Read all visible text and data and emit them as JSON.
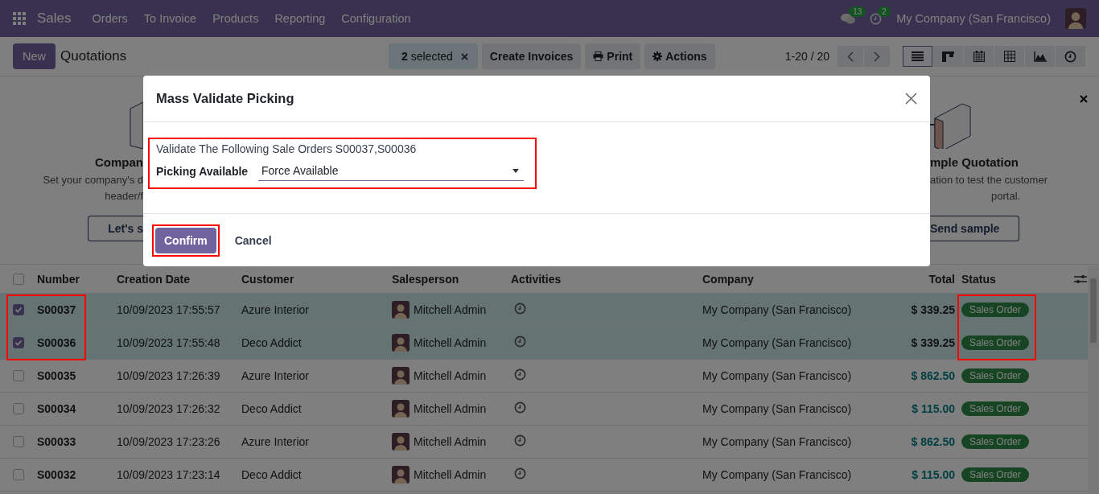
{
  "navbar": {
    "app": "Sales",
    "menu": [
      "Orders",
      "To Invoice",
      "Products",
      "Reporting",
      "Configuration"
    ],
    "messages_badge": "13",
    "activities_badge": "2",
    "company": "My Company (San Francisco)"
  },
  "control_panel": {
    "new_button": "New",
    "title": "Quotations",
    "selection": {
      "count": "2",
      "label": "selected"
    },
    "actions": [
      {
        "label": "Create Invoices",
        "kind": "plain"
      },
      {
        "label": "Print",
        "kind": "printer"
      },
      {
        "label": "Actions",
        "kind": "gear"
      }
    ],
    "pager": "1-20 / 20",
    "views": [
      {
        "kind": "list",
        "selected": true
      },
      {
        "kind": "kanban",
        "selected": false
      },
      {
        "kind": "calendar",
        "selected": false
      },
      {
        "kind": "pivot",
        "selected": false
      },
      {
        "kind": "graph",
        "selected": false
      },
      {
        "kind": "activity",
        "selected": false
      }
    ]
  },
  "helper": {
    "left": {
      "title": "Compan",
      "lines": [
        "Set your company's d",
        "header/f"
      ],
      "button": "Let's s"
    },
    "right": {
      "title": "mple Quotation",
      "lines": [
        "ation to test the customer",
        "portal."
      ],
      "button": "Send sample"
    }
  },
  "table": {
    "header_checked": false,
    "columns": [
      "Number",
      "Creation Date",
      "Customer",
      "Salesperson",
      "Activities",
      "Company",
      "Total",
      "Status"
    ],
    "rows": [
      {
        "number": "S00037",
        "created": "10/09/2023 17:55:57",
        "customer": "Azure Interior",
        "salesperson": "Mitchell Admin",
        "company": "My Company (San Francisco)",
        "total": "$ 339.25",
        "status": "Sales Order",
        "selected": true
      },
      {
        "number": "S00036",
        "created": "10/09/2023 17:55:48",
        "customer": "Deco Addict",
        "salesperson": "Mitchell Admin",
        "company": "My Company (San Francisco)",
        "total": "$ 339.25",
        "status": "Sales Order",
        "selected": true
      },
      {
        "number": "S00035",
        "created": "10/09/2023 17:26:39",
        "customer": "Azure Interior",
        "salesperson": "Mitchell Admin",
        "company": "My Company (San Francisco)",
        "total": "$ 862.50",
        "status": "Sales Order",
        "selected": false
      },
      {
        "number": "S00034",
        "created": "10/09/2023 17:26:32",
        "customer": "Deco Addict",
        "salesperson": "Mitchell Admin",
        "company": "My Company (San Francisco)",
        "total": "$ 115.00",
        "status": "Sales Order",
        "selected": false
      },
      {
        "number": "S00033",
        "created": "10/09/2023 17:23:26",
        "customer": "Azure Interior",
        "salesperson": "Mitchell Admin",
        "company": "My Company (San Francisco)",
        "total": "$ 862.50",
        "status": "Sales Order",
        "selected": false
      },
      {
        "number": "S00032",
        "created": "10/09/2023 17:23:14",
        "customer": "Deco Addict",
        "salesperson": "Mitchell Admin",
        "company": "My Company (San Francisco)",
        "total": "$ 115.00",
        "status": "Sales Order",
        "selected": false
      }
    ]
  },
  "dialog": {
    "title": "Mass Validate Picking",
    "message": "Validate The Following Sale Orders S00037,S00036",
    "field": {
      "label": "Picking Available",
      "value": "Force Available"
    },
    "buttons": [
      {
        "label": "Confirm",
        "kind": "primary"
      },
      {
        "label": "Cancel",
        "kind": "secondary"
      }
    ]
  }
}
